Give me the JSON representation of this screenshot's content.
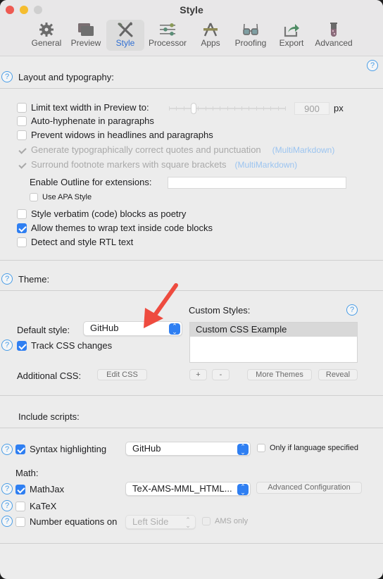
{
  "window": {
    "title": "Style"
  },
  "toolbar": {
    "items": [
      {
        "label": "General",
        "icon": "gear-icon"
      },
      {
        "label": "Preview",
        "icon": "preview-windows-icon"
      },
      {
        "label": "Style",
        "icon": "brush-pencil-icon",
        "active": true
      },
      {
        "label": "Processor",
        "icon": "sliders-icon"
      },
      {
        "label": "Apps",
        "icon": "apps-icon"
      },
      {
        "label": "Proofing",
        "icon": "glasses-icon"
      },
      {
        "label": "Export",
        "icon": "export-icon"
      },
      {
        "label": "Advanced",
        "icon": "test-tube-icon"
      }
    ]
  },
  "layout_section": {
    "title": "Layout and typography:",
    "limit_width": {
      "label": "Limit text width in Preview to:",
      "checked": false,
      "value": "900",
      "unit": "px",
      "slider_fraction": 0.21
    },
    "auto_hyphenate": {
      "label": "Auto-hyphenate in paragraphs",
      "checked": false
    },
    "prevent_widows": {
      "label": "Prevent widows in headlines and paragraphs",
      "checked": false
    },
    "smart_quotes": {
      "label": "Generate typographically correct quotes and punctuation",
      "checked": true,
      "disabled": true,
      "note": "(MultiMarkdown)"
    },
    "footnote_brackets": {
      "label": "Surround footnote markers with square brackets",
      "checked": true,
      "disabled": true,
      "note": "(MultiMarkdown)"
    },
    "outline_extensions": {
      "label": "Enable Outline for extensions:",
      "value": ""
    },
    "apa_style": {
      "label": "Use APA Style",
      "checked": false
    },
    "verbatim_poetry": {
      "label": "Style verbatim (code) blocks as poetry",
      "checked": false
    },
    "wrap_code": {
      "label": "Allow themes to wrap text inside code blocks",
      "checked": true
    },
    "rtl": {
      "label": "Detect and style RTL text",
      "checked": false
    }
  },
  "theme_section": {
    "title": "Theme:",
    "default_style_label": "Default style:",
    "default_style_value": "GitHub",
    "track_css": {
      "label": "Track CSS changes",
      "checked": true
    },
    "additional_css_label": "Additional CSS:",
    "edit_css_button": "Edit CSS",
    "custom_styles_label": "Custom Styles:",
    "custom_styles": [
      "Custom CSS Example"
    ],
    "add_button": "+",
    "remove_button": "-",
    "more_themes_button": "More Themes",
    "reveal_button": "Reveal"
  },
  "scripts_section": {
    "title": "Include scripts:",
    "syntax_highlighting": {
      "label": "Syntax highlighting",
      "checked": true,
      "value": "GitHub"
    },
    "only_if_language": {
      "label": "Only if language specified",
      "checked": false
    },
    "math_label": "Math:",
    "mathjax": {
      "label": "MathJax",
      "checked": true,
      "value": "TeX-AMS-MML_HTML..."
    },
    "advanced_config_button": "Advanced Configuration",
    "katex": {
      "label": "KaTeX",
      "checked": false
    },
    "number_equations": {
      "label": "Number equations on",
      "checked": false,
      "value": "Left Side"
    },
    "ams_only": {
      "label": "AMS only",
      "checked": false,
      "disabled": true
    }
  },
  "help_glyph": "?",
  "colors": {
    "accent": "#2f7ff2",
    "help": "#4a9de6",
    "annotation_arrow": "#ee4b3f",
    "multimarkdown_note": "#9bc4f0"
  }
}
